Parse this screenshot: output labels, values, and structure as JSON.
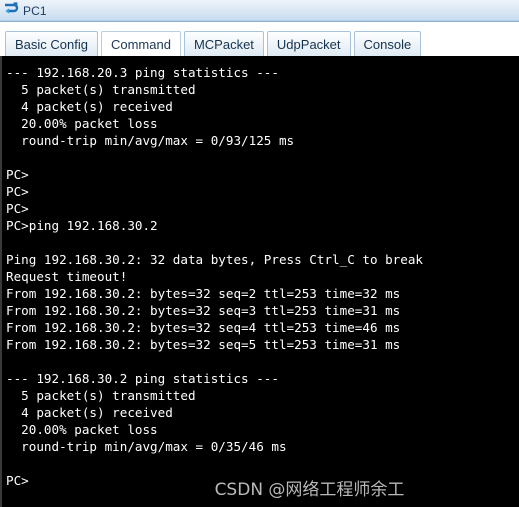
{
  "window": {
    "title": "PC1",
    "icon": "pc-terminal-icon"
  },
  "tabs": [
    {
      "label": "Basic Config",
      "active": false
    },
    {
      "label": "Command",
      "active": true
    },
    {
      "label": "MCPacket",
      "active": false
    },
    {
      "label": "UdpPacket",
      "active": false
    },
    {
      "label": "Console",
      "active": false
    }
  ],
  "terminal": {
    "prompt": "PC>",
    "text": "--- 192.168.20.3 ping statistics ---\n  5 packet(s) transmitted\n  4 packet(s) received\n  20.00% packet loss\n  round-trip min/avg/max = 0/93/125 ms\n\nPC>\nPC>\nPC>\nPC>ping 192.168.30.2\n\nPing 192.168.30.2: 32 data bytes, Press Ctrl_C to break\nRequest timeout!\nFrom 192.168.30.2: bytes=32 seq=2 ttl=253 time=32 ms\nFrom 192.168.30.2: bytes=32 seq=3 ttl=253 time=31 ms\nFrom 192.168.30.2: bytes=32 seq=4 ttl=253 time=46 ms\nFrom 192.168.30.2: bytes=32 seq=5 ttl=253 time=31 ms\n\n--- 192.168.30.2 ping statistics ---\n  5 packet(s) transmitted\n  4 packet(s) received\n  20.00% packet loss\n  round-trip min/avg/max = 0/35/46 ms\n\nPC>",
    "lines": [
      "--- 192.168.20.3 ping statistics ---",
      "  5 packet(s) transmitted",
      "  4 packet(s) received",
      "  20.00% packet loss",
      "  round-trip min/avg/max = 0/93/125 ms",
      "",
      "PC>",
      "PC>",
      "PC>",
      "PC>ping 192.168.30.2",
      "",
      "Ping 192.168.30.2: 32 data bytes, Press Ctrl_C to break",
      "Request timeout!",
      "From 192.168.30.2: bytes=32 seq=2 ttl=253 time=32 ms",
      "From 192.168.30.2: bytes=32 seq=3 ttl=253 time=31 ms",
      "From 192.168.30.2: bytes=32 seq=4 ttl=253 time=46 ms",
      "From 192.168.30.2: bytes=32 seq=5 ttl=253 time=31 ms",
      "",
      "--- 192.168.30.2 ping statistics ---",
      "  5 packet(s) transmitted",
      "  4 packet(s) received",
      "  20.00% packet loss",
      "  round-trip min/avg/max = 0/35/46 ms",
      "",
      "PC>"
    ],
    "ping_sessions": [
      {
        "target": "192.168.20.3",
        "transmitted": 5,
        "received": 4,
        "packet_loss": "20.00%",
        "min_ms": 0,
        "avg_ms": 93,
        "max_ms": 125
      },
      {
        "target": "192.168.30.2",
        "data_bytes": 32,
        "break_hint": "Press Ctrl_C to break",
        "replies": [
          {
            "status": "Request timeout!"
          },
          {
            "from": "192.168.30.2",
            "bytes": 32,
            "seq": 2,
            "ttl": 253,
            "time_ms": 32
          },
          {
            "from": "192.168.30.2",
            "bytes": 32,
            "seq": 3,
            "ttl": 253,
            "time_ms": 31
          },
          {
            "from": "192.168.30.2",
            "bytes": 32,
            "seq": 4,
            "ttl": 253,
            "time_ms": 46
          },
          {
            "from": "192.168.30.2",
            "bytes": 32,
            "seq": 5,
            "ttl": 253,
            "time_ms": 31
          }
        ],
        "transmitted": 5,
        "received": 4,
        "packet_loss": "20.00%",
        "min_ms": 0,
        "avg_ms": 35,
        "max_ms": 46
      }
    ]
  },
  "watermark": {
    "text": "CSDN @网络工程师余工"
  },
  "colors": {
    "titlebar_start": "#eef4fb",
    "titlebar_end": "#9dc1dd",
    "title_text": "#1f3c64",
    "tab_border": "#a8c3d9",
    "terminal_bg": "#000000",
    "terminal_fg": "#ffffff",
    "watermark": "#b9b9b9"
  }
}
